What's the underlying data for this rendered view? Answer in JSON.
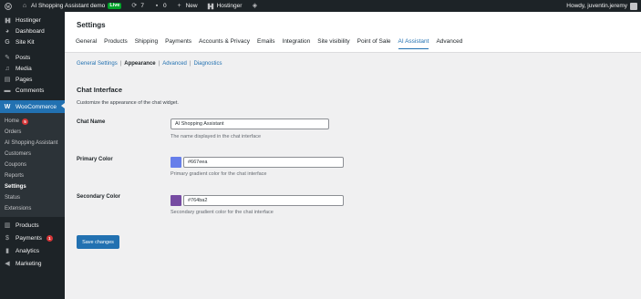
{
  "colors": {
    "accent": "#2271b1",
    "adminbar": "#1d2327",
    "live": "#00a32a",
    "badge": "#d63638"
  },
  "adminbar": {
    "site_name": "AI Shopping Assistant demo",
    "live_label": "Live",
    "updates_count": "7",
    "comments_count": "0",
    "new_label": "New",
    "hostinger_label": "Hostinger",
    "greeting": "Howdy, juventin.jeremy"
  },
  "sidebar": {
    "hostinger": "Hostinger",
    "dashboard": "Dashboard",
    "sitekit": "Site Kit",
    "posts": "Posts",
    "media": "Media",
    "pages": "Pages",
    "comments": "Comments",
    "woocommerce": "WooCommerce",
    "sub": {
      "home": "Home",
      "home_count": "5",
      "orders": "Orders",
      "ai": "AI Shopping Assistant",
      "customers": "Customers",
      "coupons": "Coupons",
      "reports": "Reports",
      "settings": "Settings",
      "status": "Status",
      "extensions": "Extensions"
    },
    "products": "Products",
    "payments": "Payments",
    "payments_count": "1",
    "analytics": "Analytics",
    "marketing": "Marketing"
  },
  "header": {
    "title": "Settings",
    "tabs": [
      "General",
      "Products",
      "Shipping",
      "Payments",
      "Accounts & Privacy",
      "Emails",
      "Integration",
      "Site visibility",
      "Point of Sale",
      "AI Assistant",
      "Advanced"
    ]
  },
  "subnav": {
    "general": "General Settings",
    "appearance": "Appearance",
    "advanced": "Advanced",
    "diagnostics": "Diagnostics",
    "sep": "|"
  },
  "section": {
    "title": "Chat Interface",
    "desc": "Customize the appearance of the chat widget."
  },
  "fields": {
    "chat_name": {
      "label": "Chat Name",
      "value": "AI Shopping Assistant",
      "desc": "The name displayed in the chat interface"
    },
    "primary": {
      "label": "Primary Color",
      "value": "#667eea",
      "desc": "Primary gradient color for the chat interface"
    },
    "secondary": {
      "label": "Secondary Color",
      "value": "#764ba2",
      "desc": "Secondary gradient color for the chat interface"
    }
  },
  "save_label": "Save changes"
}
